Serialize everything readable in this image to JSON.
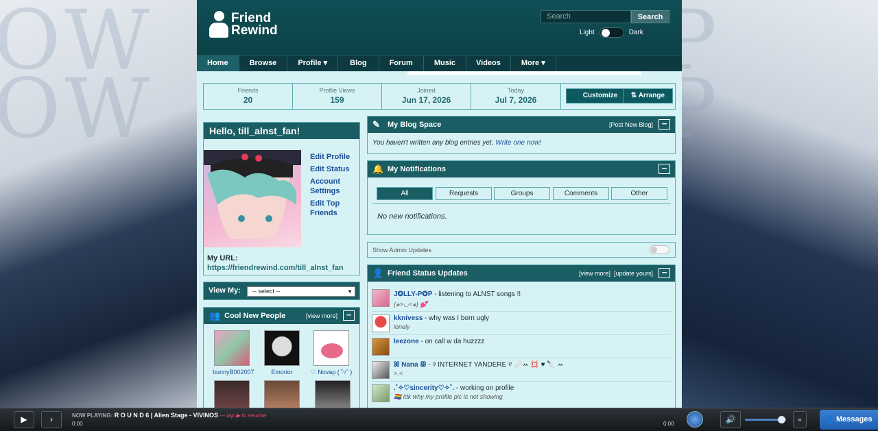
{
  "app": {
    "logo_line1": "Friend",
    "logo_line2": "Rewind"
  },
  "search": {
    "placeholder": "Search",
    "button": "Search"
  },
  "theme": {
    "light": "Light",
    "dark": "Dark"
  },
  "nav": [
    "Home",
    "Browse",
    "Profile ▾",
    "Blog",
    "Forum",
    "Music",
    "Videos",
    "More ▾"
  ],
  "stats": [
    {
      "label": "Friends",
      "value": "20"
    },
    {
      "label": "Profile Views",
      "value": "159"
    },
    {
      "label": "Joined",
      "value": "Jun 17, 2026"
    },
    {
      "label": "Today",
      "value": "Jul 7, 2026"
    }
  ],
  "actions": {
    "customize": "Customize",
    "arrange": "⇅ Arrange"
  },
  "profile": {
    "greeting": "Hello, till_alnst_fan!",
    "links": [
      "Edit Profile",
      "Edit Status",
      "Account Settings",
      "Edit Top Friends"
    ],
    "url_label": "My URL:",
    "url": "https://friendrewind.com/till_alnst_fan"
  },
  "view_my": {
    "label": "View My:",
    "selected": "-- select --"
  },
  "cool_people": {
    "title": "Cool New People",
    "view_more": "[view more]",
    "people": [
      {
        "name": "bunnyB002007"
      },
      {
        "name": "Emorior"
      },
      {
        "name": "♡ Novap ( ˘▿˘ )"
      }
    ]
  },
  "blog": {
    "title": "My Blog Space",
    "post_link": "[Post New Blog]",
    "empty": "You haven't written any blog entries yet.",
    "write_link": "Write one now!"
  },
  "notifications": {
    "title": "My Notifications",
    "tabs": [
      "All",
      "Requests",
      "Groups",
      "Comments",
      "Other"
    ],
    "empty": "No new notifications."
  },
  "admin": {
    "label": "Show Admin Updates"
  },
  "status_updates": {
    "title": "Friend Status Updates",
    "view_more": "[view more]",
    "update": "[update yours]",
    "rows": [
      {
        "name": "J✪LLY-P✪P",
        "text": "- listening to ALNST songs !!",
        "sub": "(๑>◡<๑) 💕"
      },
      {
        "name": "kknivess",
        "text": "- why was I born ugly",
        "sub": "lonely"
      },
      {
        "name": "leezone",
        "text": "- on call w da huzzzz",
        "sub": ""
      },
      {
        "name": "ꕤ Nana ꕥ",
        "text": "- ୨ INTERNET YANDERE ୧ 🩹ꕀ 💢 ♥ 🔪 ꕀ",
        "sub": ">.<"
      },
      {
        "name": ".˚✧♡sincerity♡✧˚.",
        "text": "- working on profile",
        "sub": "🏳️‍🌈 idk why my profile pic is not showing"
      }
    ]
  },
  "player": {
    "now_playing_label": "NOW PLAYING:",
    "track": "R O U N D 6 | Alien Stage - VIVINOS",
    "hint": "— tap ▶ to resume",
    "time_left": "0:00",
    "time_right": "0:00",
    "messages": "Messages"
  },
  "colors": {
    "accent": "#1a5d63",
    "panel_bg": "#d7f2f5",
    "link": "#1b4f96"
  }
}
